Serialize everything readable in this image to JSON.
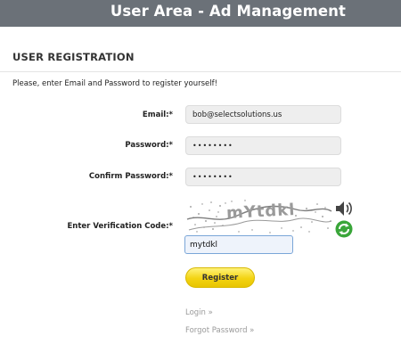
{
  "header": {
    "title": "User Area - Ad Management"
  },
  "section": {
    "title": "USER REGISTRATION",
    "intro": "Please, enter Email and Password to register yourself!"
  },
  "form": {
    "email": {
      "label": "Email:*",
      "value": "bob@selectsolutions.us"
    },
    "password": {
      "label": "Password:*",
      "value": "••••••••"
    },
    "confirm_password": {
      "label": "Confirm Password:*",
      "value": "••••••••"
    },
    "verification": {
      "label": "Enter Verification Code:*",
      "captcha_text": "mYtdkl",
      "input_value": "mytdkl",
      "audio_icon": "speaker-icon",
      "refresh_icon": "refresh-icon"
    },
    "register_label": "Register"
  },
  "links": {
    "login": "Login »",
    "forgot_password": "Forgot Password »"
  },
  "colors": {
    "header_bg": "#6b7178",
    "button_yellow": "#f3d312",
    "refresh_green": "#3aa63a",
    "link_gray": "#9a9a9a"
  }
}
